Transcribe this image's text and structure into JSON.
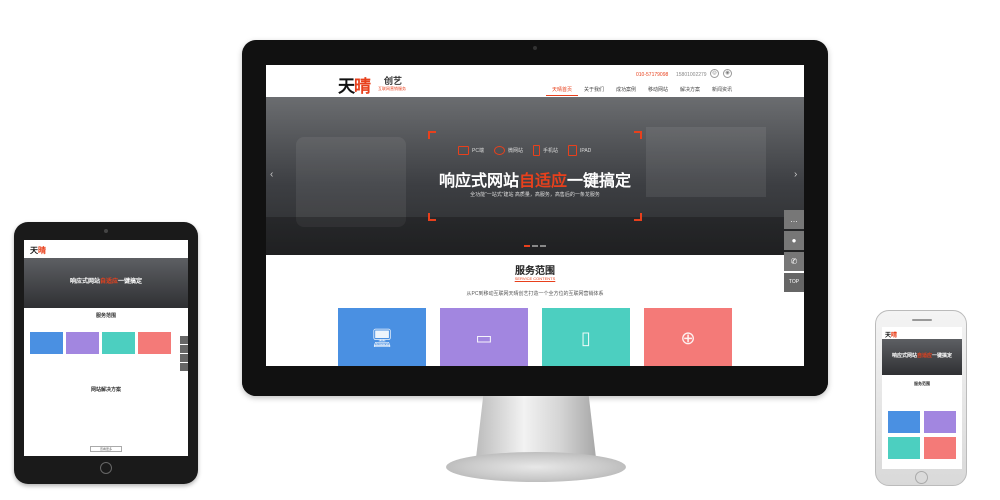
{
  "site": {
    "logo_main": "天",
    "logo_hl": "晴",
    "logo_sub": "创艺",
    "logo_slogan": "互联网营销服务",
    "phone1": "010-57179098",
    "phone2": "15801002279",
    "nav": [
      "天晴首页",
      "关于我们",
      "成功案例",
      "移动网站",
      "解决方案",
      "新闻资讯"
    ]
  },
  "banner": {
    "devices": [
      "PC端",
      "微网站",
      "手机站",
      "IPAD"
    ],
    "headline_pre": "响应式网站",
    "headline_hl": "自适应",
    "headline_post": "一键搞定",
    "subline": "全功能“一站式”建站 高质量，高服务，高售后的一条龙服务"
  },
  "services": {
    "title": "服务范围",
    "en": "SERVICE CONTENTS",
    "desc": "从PC到移动互联网天晴创艺打造一个全方位的互联网营销体系",
    "cards": [
      {
        "color": "#4a90e2",
        "icon": "pc-click-icon"
      },
      {
        "color": "#a286e0",
        "icon": "multi-device-icon"
      },
      {
        "color": "#4ccfc0",
        "icon": "mobile-wechat-icon"
      },
      {
        "color": "#f47a78",
        "icon": "www-plus-icon"
      }
    ]
  },
  "side_tools": [
    "chat-icon",
    "qq-icon",
    "phone-icon",
    "TOP"
  ],
  "tablet": {
    "headline_pre": "响应式网站",
    "headline_hl": "自适应",
    "headline_post": "一键搞定",
    "section1": "服务范围",
    "section2": "网站解决方案",
    "button": "查看更多"
  },
  "phone_device": {
    "headline_pre": "响应式网站",
    "headline_hl": "自适应",
    "headline_post": "一键搞定",
    "section1": "服务范围"
  }
}
